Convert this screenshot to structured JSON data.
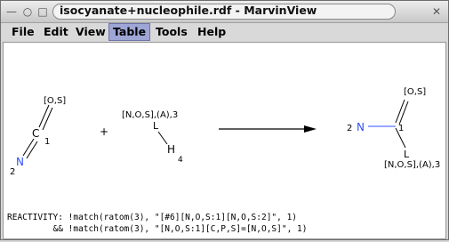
{
  "window": {
    "title": "isocyanate+nucleophile.rdf - MarvinView",
    "controls": {
      "menu": "—",
      "minimize": "○",
      "maximize": "□",
      "close": "✕"
    }
  },
  "menubar": {
    "items": [
      "File",
      "Edit",
      "View",
      "Table",
      "Tools",
      "Help"
    ],
    "active": "Table"
  },
  "reaction": {
    "reactant1": {
      "atom_top": "[O,S]",
      "atom_c": "C",
      "map1": "1",
      "atom_n": "N",
      "map2": "2"
    },
    "plus": "+",
    "reactant2": {
      "atom_top": "[N,O,S],(A),3",
      "atom_l": "L",
      "atom_h": "H",
      "map4": "4"
    },
    "product": {
      "atom_top": "[O,S]",
      "map2": "2",
      "atom_n": "N",
      "map1": "1",
      "atom_l": "L",
      "atom_bottom": "[N,O,S],(A),3"
    }
  },
  "reactivity": {
    "line1": "REACTIVITY: !match(ratom(3), \"[#6][N,O,S:1][N,O,S:2]\", 1)",
    "line2": "         && !match(ratom(3), \"[N,O,S:1][C,P,S]=[N,O,S]\", 1)"
  },
  "colors": {
    "nitrogen": "#3050f8",
    "bond": "#000000",
    "active_menu": "#9ea6d6"
  }
}
